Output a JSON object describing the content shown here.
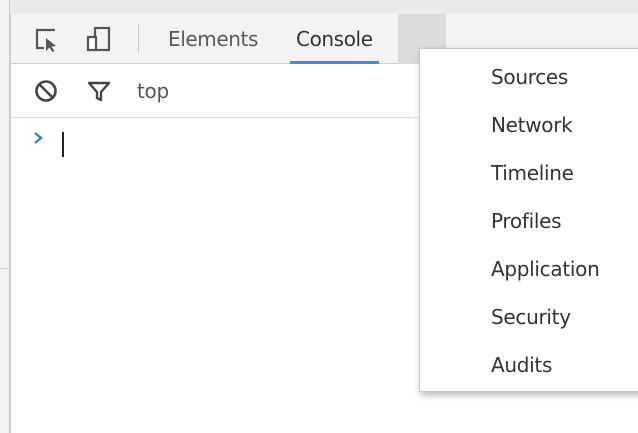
{
  "tabs": [
    {
      "label": "Elements"
    },
    {
      "label": "Console",
      "active": true
    }
  ],
  "toolbar": {
    "context": "top"
  },
  "menu": {
    "items": [
      {
        "label": "Sources"
      },
      {
        "label": "Network"
      },
      {
        "label": "Timeline"
      },
      {
        "label": "Profiles"
      },
      {
        "label": "Application"
      },
      {
        "label": "Security"
      },
      {
        "label": "Audits"
      }
    ]
  },
  "icons": {
    "inspect": "inspect-element-icon",
    "device": "device-toolbar-icon",
    "clear": "clear-console-icon",
    "filter": "filter-icon",
    "prompt": "prompt-chevron-icon"
  },
  "colors": {
    "accent": "#4a86e8",
    "prompt": "#3b7bd6"
  }
}
